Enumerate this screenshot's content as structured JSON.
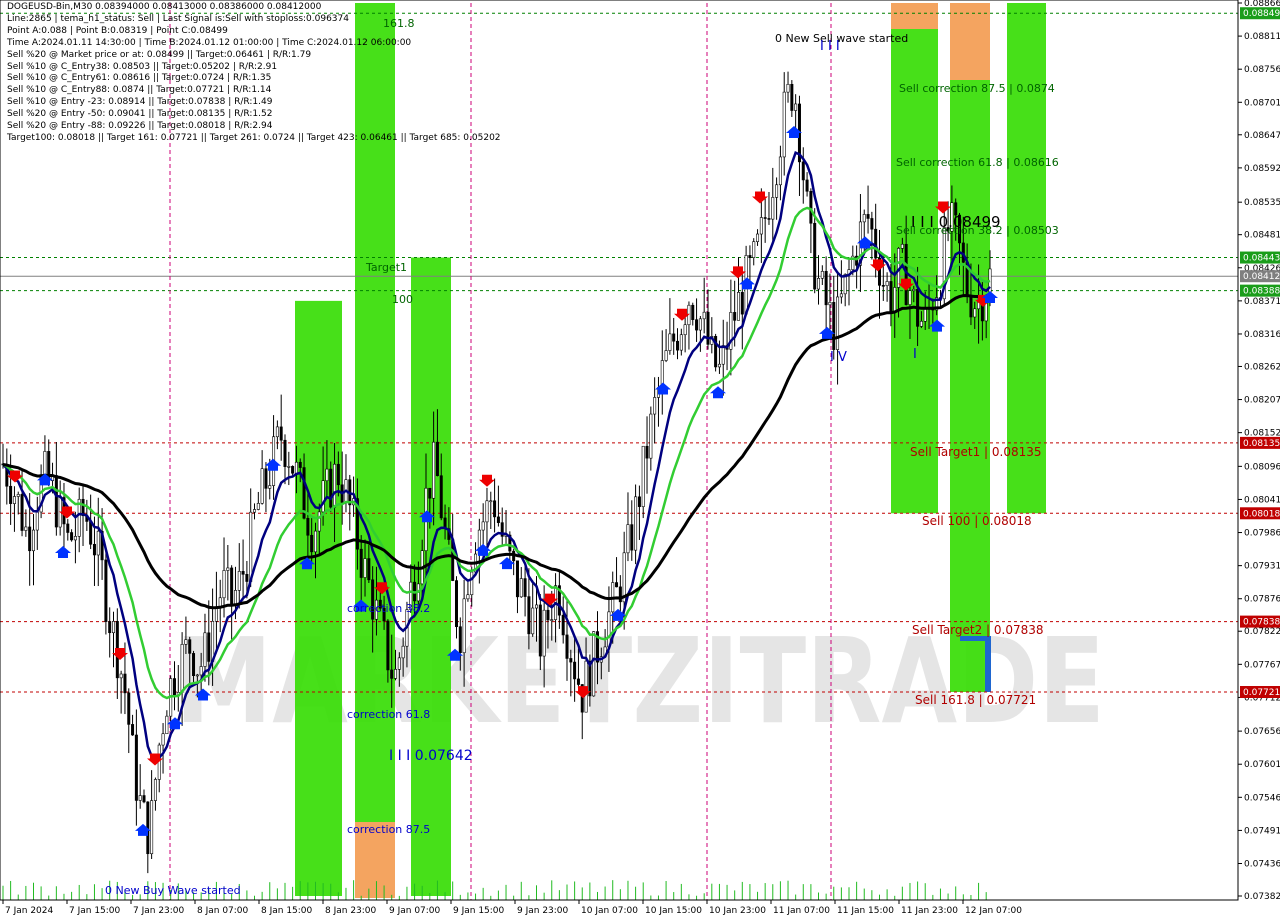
{
  "info_panel": {
    "lines": [
      "DOGEUSD-Bin,M30  0.08394000 0.08413000 0.08386000 0.08412000",
      "Line:2865 | tema_h1_status: Sell | Last Signal is:Sell with stoploss:0.096374",
      "Point A:0.088 | Point B:0.08319 | Point C:0.08499",
      "Time A:2024.01.11 14:30:00 | Time B:2024.01.12 01:00:00 | Time C:2024.01.12 06:00:00",
      "Sell %20 @ Market price or at: 0.08499 || Target:0.06461 | R/R:1.79",
      "Sell %10 @ C_Entry38: 0.08503 || Target:0.05202 | R/R:2.91",
      "Sell %10 @ C_Entry61: 0.08616 || Target:0.0724 | R/R:1.35",
      "Sell %10 @ C_Entry88: 0.0874 || Target:0.07721 | R/R:1.14",
      "Sell %10 @ Entry -23: 0.08914 || Target:0.07838 | R/R:1.49",
      "Sell %20 @ Entry -50: 0.09041 || Target:0.08135 | R/R:1.52",
      "Sell %20 @ Entry -88: 0.09226 || Target:0.08018 | R/R:2.94",
      "Target100: 0.08018 || Target 161: 0.07721 || Target 261: 0.0724 || Target 423: 0.06461 || Target 685: 0.05202"
    ]
  },
  "watermark": "MARKETZITRADE",
  "colors": {
    "bull_candle": "#000000",
    "bear_candle": "#000000",
    "ma_fast": "#000080",
    "ma_mid": "#32cd32",
    "ma_slow": "#000000",
    "zone_green": "#33dd00",
    "zone_orange": "#f4a460",
    "level_red": "#c00000",
    "level_green": "#008000",
    "vline": "#cc0077",
    "label_blue": "#0000cc",
    "label_red": "#b00000",
    "label_green": "#006400"
  },
  "chart_data": {
    "type": "candlestick",
    "symbol": "DOGEUSD-Bin",
    "timeframe": "M30",
    "ylim": [
      0.07382,
      0.08866
    ],
    "y_ticks": [
      "0.08866",
      "0.08811",
      "0.08756",
      "0.08701",
      "0.08647",
      "0.08592",
      "0.08535",
      "0.08481",
      "0.08426",
      "0.08371",
      "0.08316",
      "0.08262",
      "0.08207",
      "0.08152",
      "0.08096",
      "0.08041",
      "0.07986",
      "0.07931",
      "0.07876",
      "0.07822",
      "0.07767",
      "0.07712",
      "0.07656",
      "0.07601",
      "0.07546",
      "0.07491",
      "0.07436",
      "0.07382"
    ],
    "x_ticks": [
      "7 Jan 2024",
      "7 Jan 15:00",
      "7 Jan 23:00",
      "8 Jan 07:00",
      "8 Jan 15:00",
      "8 Jan 23:00",
      "9 Jan 07:00",
      "9 Jan 15:00",
      "9 Jan 23:00",
      "10 Jan 07:00",
      "10 Jan 15:00",
      "10 Jan 23:00",
      "11 Jan 07:00",
      "11 Jan 15:00",
      "11 Jan 23:00",
      "12 Jan 07:00"
    ],
    "price_tags": [
      {
        "value": "0.08849",
        "style": "green"
      },
      {
        "value": "0.08443",
        "style": "green"
      },
      {
        "value": "0.08412",
        "style": "gray"
      },
      {
        "value": "0.08388",
        "style": "green"
      },
      {
        "value": "0.08135",
        "style": "red"
      },
      {
        "value": "0.08018",
        "style": "red"
      },
      {
        "value": "0.07838",
        "style": "red"
      },
      {
        "value": "0.07721",
        "style": "red"
      }
    ],
    "levels": [
      {
        "price": 0.08849,
        "color": "green"
      },
      {
        "price": 0.08443,
        "color": "green"
      },
      {
        "price": 0.08412,
        "color": "gray"
      },
      {
        "price": 0.08388,
        "color": "green"
      },
      {
        "price": 0.08135,
        "color": "red"
      },
      {
        "price": 0.08018,
        "color": "red"
      },
      {
        "price": 0.07838,
        "color": "red"
      },
      {
        "price": 0.07721,
        "color": "red"
      }
    ],
    "vertical_lines": [
      "7 Jan 23:00 +",
      "9 Jan 15:00 -",
      "10 Jan 23:00 -",
      "11 Jan 14:30"
    ],
    "labels": [
      {
        "text": "161.8",
        "color": "green"
      },
      {
        "text": "Target1",
        "color": "green"
      },
      {
        "text": "100",
        "color": "green"
      },
      {
        "text": "0 New Sell wave started",
        "color": "black"
      },
      {
        "text": "I I I",
        "color": "blue"
      },
      {
        "text": "Sell correction 87.5 | 0.0874",
        "color": "green"
      },
      {
        "text": "Sell correction 61.8 | 0.08616",
        "color": "green"
      },
      {
        "text": "I I I 0.08499",
        "color": "black"
      },
      {
        "text": "Sell correction 38.2 | 0.08503",
        "color": "green"
      },
      {
        "text": "I V",
        "color": "blue"
      },
      {
        "text": "I",
        "color": "blue"
      },
      {
        "text": "Sell Target1 | 0.08135",
        "color": "red"
      },
      {
        "text": "Sell 100 | 0.08018",
        "color": "red"
      },
      {
        "text": "Sell Target2 | 0.07838",
        "color": "red"
      },
      {
        "text": "Sell 161.8 | 0.07721",
        "color": "red"
      },
      {
        "text": "correction 38.2",
        "color": "blue"
      },
      {
        "text": "correction 61.8",
        "color": "blue"
      },
      {
        "text": "I I I 0.07642",
        "color": "blue"
      },
      {
        "text": "correction 87.5",
        "color": "blue"
      },
      {
        "text": "0 New Buy Wave started",
        "color": "blue"
      }
    ],
    "zones": [
      {
        "from": "8 Jan 15:00",
        "price_top": 0.08371,
        "price_bottom": 0.07382,
        "color": "green"
      },
      {
        "from": "8 Jan 23:00",
        "price_top": 0.08866,
        "price_bottom": 0.07382,
        "color": "green"
      },
      {
        "from": "9 Jan 07:00",
        "price_top": 0.08443,
        "price_bottom": 0.07382,
        "color": "green"
      },
      {
        "from": "11 Jan 23:00",
        "price_top": 0.08866,
        "price_bottom": 0.08018,
        "color": "green"
      },
      {
        "from": "12 Jan 07:00",
        "price_top": 0.08866,
        "price_bottom": 0.07721,
        "color": "green"
      },
      {
        "from": "12 Jan 15:00",
        "price_top": 0.08866,
        "price_bottom": 0.08018,
        "color": "green"
      }
    ],
    "candle_path": [
      0.081,
      0.0807,
      0.0803,
      0.0798,
      0.0804,
      0.0808,
      0.0806,
      0.0801,
      0.0797,
      0.0799,
      0.0802,
      0.0798,
      0.0793,
      0.0785,
      0.0779,
      0.0772,
      0.076,
      0.0752,
      0.0748,
      0.0762,
      0.0771,
      0.0775,
      0.0778,
      0.078,
      0.0776,
      0.0779,
      0.0786,
      0.079,
      0.0787,
      0.079,
      0.0795,
      0.0802,
      0.0806,
      0.081,
      0.0815,
      0.0812,
      0.0808,
      0.0803,
      0.0799,
      0.0803,
      0.0806,
      0.0809,
      0.0805,
      0.08,
      0.0794,
      0.0789,
      0.0784,
      0.0779,
      0.0774,
      0.0781,
      0.0789,
      0.0795,
      0.0806,
      0.081,
      0.08,
      0.079,
      0.0782,
      0.0792,
      0.0799,
      0.0801,
      0.0805,
      0.0799,
      0.0794,
      0.079,
      0.0788,
      0.0784,
      0.078,
      0.0786,
      0.079,
      0.0783,
      0.0777,
      0.0772,
      0.0776,
      0.078,
      0.0784,
      0.0787,
      0.0792,
      0.0798,
      0.0805,
      0.0813,
      0.082,
      0.0826,
      0.083,
      0.0833,
      0.0838,
      0.0836,
      0.0832,
      0.0827,
      0.0825,
      0.0832,
      0.0836,
      0.084,
      0.0843,
      0.0848,
      0.0855,
      0.0862,
      0.087,
      0.0873,
      0.086,
      0.0846,
      0.084,
      0.0836,
      0.0832,
      0.0838,
      0.0843,
      0.0848,
      0.0851,
      0.0846,
      0.084,
      0.0838,
      0.0843,
      0.084,
      0.0835,
      0.0833,
      0.0838,
      0.0842,
      0.085,
      0.0847,
      0.084,
      0.0837,
      0.0838,
      0.0841
    ]
  }
}
